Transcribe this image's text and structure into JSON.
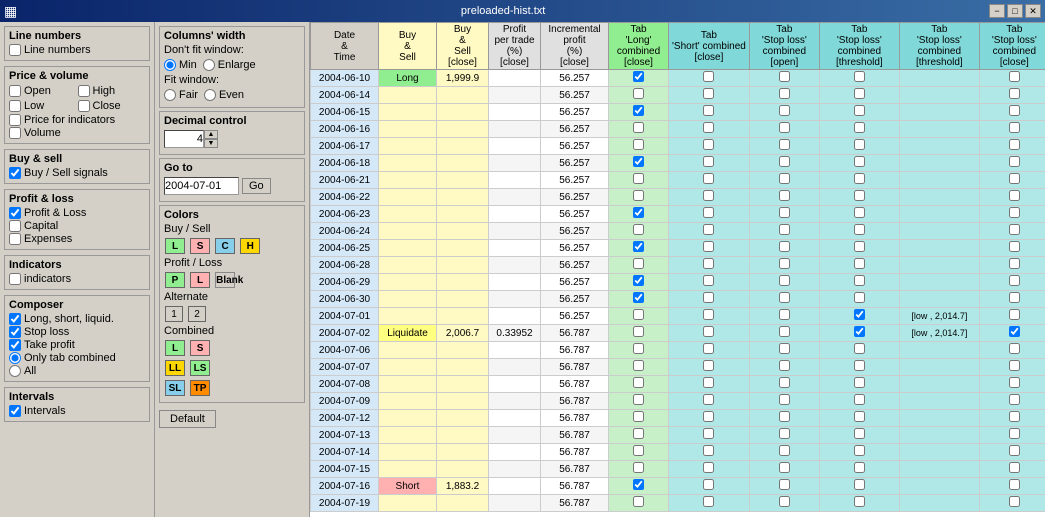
{
  "titlebar": {
    "title": "preloaded-hist.txt",
    "icon": "▦",
    "min_label": "−",
    "max_label": "□",
    "close_label": "✕"
  },
  "left_panel": {
    "sections": {
      "line_numbers": {
        "title": "Line numbers",
        "checkbox_label": "Line numbers"
      },
      "price_volume": {
        "title": "Price & volume",
        "items": [
          "Open",
          "High",
          "Low",
          "Close",
          "Price for indicators",
          "Volume"
        ]
      },
      "buy_sell": {
        "title": "Buy & sell",
        "checkbox_label": "Buy / Sell signals"
      },
      "profit_loss": {
        "title": "Profit & loss",
        "items": [
          "Profit & Loss",
          "Capital",
          "Expenses"
        ]
      },
      "indicators": {
        "title": "Indicators",
        "checkbox_label": "indicators"
      },
      "composer": {
        "title": "Composer",
        "items": [
          "Long, short, liquid.",
          "Stop loss",
          "Take profit"
        ],
        "radio_items": [
          "Only tab combined",
          "All"
        ]
      },
      "intervals": {
        "title": "Intervals",
        "checkbox_label": "Intervals"
      }
    }
  },
  "mid_panel": {
    "columns_width": {
      "title": "Columns' width",
      "dont_fit_label": "Don't fit window:",
      "min_label": "Min",
      "enlarge_label": "Enlarge",
      "fit_label": "Fit window:",
      "fair_label": "Fair",
      "even_label": "Even"
    },
    "decimal_control": {
      "title": "Decimal control",
      "value": "4"
    },
    "go_to": {
      "title": "Go to",
      "value": "2004-07-01",
      "btn_label": "Go"
    },
    "colors": {
      "title": "Colors",
      "buy_sell_label": "Buy / Sell",
      "btns": [
        {
          "label": "L",
          "bg": "#90EE90"
        },
        {
          "label": "S",
          "bg": "#FFB0B0"
        },
        {
          "label": "C",
          "bg": "#87CEEB"
        },
        {
          "label": "H",
          "bg": "#FFD700"
        }
      ],
      "profit_loss_label": "Profit / Loss",
      "pl_btns": [
        {
          "label": "P",
          "bg": "#90EE90"
        },
        {
          "label": "L",
          "bg": "#FFB0B0"
        },
        {
          "label": "Blank",
          "bg": "#d4d0c8"
        }
      ],
      "alternate_label": "Alternate",
      "alt_btns": [
        "1",
        "2"
      ],
      "combined_label": "Combined",
      "combined_btns": [
        [
          {
            "label": "L",
            "bg": "#90EE90"
          },
          {
            "label": "S",
            "bg": "#FFB0B0"
          }
        ],
        [
          {
            "label": "LL",
            "bg": "#FFD700"
          },
          {
            "label": "LS",
            "bg": "#90EE90"
          }
        ],
        [
          {
            "label": "SL",
            "bg": "#87CEEB"
          },
          {
            "label": "TP",
            "bg": "#FF8C00"
          }
        ]
      ]
    },
    "default_btn": "Default"
  },
  "table": {
    "headers": [
      {
        "label": "Date\n&\nTime",
        "class": "col-date"
      },
      {
        "label": "Buy\n&\nSell",
        "class": "col-buy-sell"
      },
      {
        "label": "Buy\n&\nSell\n[close]",
        "class": "col-buy-sell"
      },
      {
        "label": "Profit\nper trade\n(%)\n[close]",
        "class": "col-profit"
      },
      {
        "label": "Incremental\nprofit\n(%)\n[close]",
        "class": "col-inc-profit"
      },
      {
        "label": "Tab\n'Long'\ncombined\n[close]",
        "class": "col-combined"
      },
      {
        "label": "Tab\n'Short' combined\n[close]",
        "class": "col-combined2"
      },
      {
        "label": "Tab\n'Stop loss'\ncombined\n[open]",
        "class": "col-combined2"
      },
      {
        "label": "Tab\n'Stop loss'\ncombined\n[threshold]",
        "class": "col-combined2"
      },
      {
        "label": "Tab\n'Stop loss'\ncombined\n[threshold]",
        "class": "col-combined2"
      },
      {
        "label": "Tab\n'Stop loss'\ncombined\n[close]",
        "class": "col-combined2"
      }
    ],
    "rows": [
      {
        "date": "2004-06-10",
        "buy_sell": "Long",
        "buy_close": "1,999.9",
        "profit": "",
        "inc_profit": "56.257",
        "c1": "✔",
        "c2": "",
        "c3": "",
        "c4": "",
        "c5": "",
        "c6": ""
      },
      {
        "date": "2004-06-14",
        "buy_sell": "",
        "buy_close": "",
        "profit": "",
        "inc_profit": "56.257",
        "c1": "",
        "c2": "",
        "c3": "",
        "c4": "",
        "c5": "",
        "c6": ""
      },
      {
        "date": "2004-06-15",
        "buy_sell": "",
        "buy_close": "",
        "profit": "",
        "inc_profit": "56.257",
        "c1": "✔",
        "c2": "",
        "c3": "",
        "c4": "",
        "c5": "",
        "c6": ""
      },
      {
        "date": "2004-06-16",
        "buy_sell": "",
        "buy_close": "",
        "profit": "",
        "inc_profit": "56.257",
        "c1": "",
        "c2": "",
        "c3": "",
        "c4": "",
        "c5": "",
        "c6": ""
      },
      {
        "date": "2004-06-17",
        "buy_sell": "",
        "buy_close": "",
        "profit": "",
        "inc_profit": "56.257",
        "c1": "",
        "c2": "",
        "c3": "",
        "c4": "",
        "c5": "",
        "c6": ""
      },
      {
        "date": "2004-06-18",
        "buy_sell": "",
        "buy_close": "",
        "profit": "",
        "inc_profit": "56.257",
        "c1": "✔",
        "c2": "",
        "c3": "",
        "c4": "",
        "c5": "",
        "c6": ""
      },
      {
        "date": "2004-06-21",
        "buy_sell": "",
        "buy_close": "",
        "profit": "",
        "inc_profit": "56.257",
        "c1": "",
        "c2": "",
        "c3": "",
        "c4": "",
        "c5": "",
        "c6": ""
      },
      {
        "date": "2004-06-22",
        "buy_sell": "",
        "buy_close": "",
        "profit": "",
        "inc_profit": "56.257",
        "c1": "",
        "c2": "",
        "c3": "",
        "c4": "",
        "c5": "",
        "c6": ""
      },
      {
        "date": "2004-06-23",
        "buy_sell": "",
        "buy_close": "",
        "profit": "",
        "inc_profit": "56.257",
        "c1": "✔",
        "c2": "",
        "c3": "",
        "c4": "",
        "c5": "",
        "c6": ""
      },
      {
        "date": "2004-06-24",
        "buy_sell": "",
        "buy_close": "",
        "profit": "",
        "inc_profit": "56.257",
        "c1": "",
        "c2": "",
        "c3": "",
        "c4": "",
        "c5": "",
        "c6": ""
      },
      {
        "date": "2004-06-25",
        "buy_sell": "",
        "buy_close": "",
        "profit": "",
        "inc_profit": "56.257",
        "c1": "✔",
        "c2": "",
        "c3": "",
        "c4": "",
        "c5": "",
        "c6": ""
      },
      {
        "date": "2004-06-28",
        "buy_sell": "",
        "buy_close": "",
        "profit": "",
        "inc_profit": "56.257",
        "c1": "",
        "c2": "",
        "c3": "",
        "c4": "",
        "c5": "",
        "c6": ""
      },
      {
        "date": "2004-06-29",
        "buy_sell": "",
        "buy_close": "",
        "profit": "",
        "inc_profit": "56.257",
        "c1": "✔",
        "c2": "",
        "c3": "",
        "c4": "",
        "c5": "",
        "c6": ""
      },
      {
        "date": "2004-06-30",
        "buy_sell": "",
        "buy_close": "",
        "profit": "",
        "inc_profit": "56.257",
        "c1": "✔",
        "c2": "",
        "c3": "",
        "c4": "",
        "c5": "",
        "c6": ""
      },
      {
        "date": "2004-07-01",
        "buy_sell": "",
        "buy_close": "",
        "profit": "",
        "inc_profit": "56.257",
        "c1": "",
        "c2": "",
        "c3": "",
        "c4": "✔",
        "c5": "[low , 2,014.7]",
        "c6": ""
      },
      {
        "date": "2004-07-02",
        "buy_sell": "Liquidate",
        "buy_close": "2,006.7",
        "profit": "0.33952",
        "inc_profit": "56.787",
        "c1": "",
        "c2": "",
        "c3": "",
        "c4": "✔",
        "c5": "[low , 2,014.7]",
        "c6": "✔"
      },
      {
        "date": "2004-07-06",
        "buy_sell": "",
        "buy_close": "",
        "profit": "",
        "inc_profit": "56.787",
        "c1": "",
        "c2": "",
        "c3": "",
        "c4": "",
        "c5": "",
        "c6": ""
      },
      {
        "date": "2004-07-07",
        "buy_sell": "",
        "buy_close": "",
        "profit": "",
        "inc_profit": "56.787",
        "c1": "",
        "c2": "",
        "c3": "",
        "c4": "",
        "c5": "",
        "c6": ""
      },
      {
        "date": "2004-07-08",
        "buy_sell": "",
        "buy_close": "",
        "profit": "",
        "inc_profit": "56.787",
        "c1": "",
        "c2": "",
        "c3": "",
        "c4": "",
        "c5": "",
        "c6": ""
      },
      {
        "date": "2004-07-09",
        "buy_sell": "",
        "buy_close": "",
        "profit": "",
        "inc_profit": "56.787",
        "c1": "",
        "c2": "",
        "c3": "",
        "c4": "",
        "c5": "",
        "c6": ""
      },
      {
        "date": "2004-07-12",
        "buy_sell": "",
        "buy_close": "",
        "profit": "",
        "inc_profit": "56.787",
        "c1": "",
        "c2": "",
        "c3": "",
        "c4": "",
        "c5": "",
        "c6": ""
      },
      {
        "date": "2004-07-13",
        "buy_sell": "",
        "buy_close": "",
        "profit": "",
        "inc_profit": "56.787",
        "c1": "",
        "c2": "",
        "c3": "",
        "c4": "",
        "c5": "",
        "c6": ""
      },
      {
        "date": "2004-07-14",
        "buy_sell": "",
        "buy_close": "",
        "profit": "",
        "inc_profit": "56.787",
        "c1": "",
        "c2": "",
        "c3": "",
        "c4": "",
        "c5": "",
        "c6": ""
      },
      {
        "date": "2004-07-15",
        "buy_sell": "",
        "buy_close": "",
        "profit": "",
        "inc_profit": "56.787",
        "c1": "",
        "c2": "",
        "c3": "",
        "c4": "",
        "c5": "",
        "c6": ""
      },
      {
        "date": "2004-07-16",
        "buy_sell": "Short",
        "buy_close": "1,883.2",
        "profit": "",
        "inc_profit": "56.787",
        "c1": "✔",
        "c2": "",
        "c3": "",
        "c4": "",
        "c5": "",
        "c6": ""
      },
      {
        "date": "2004-07-19",
        "buy_sell": "",
        "buy_close": "",
        "profit": "",
        "inc_profit": "56.787",
        "c1": "",
        "c2": "",
        "c3": "",
        "c4": "",
        "c5": "",
        "c6": ""
      }
    ]
  }
}
